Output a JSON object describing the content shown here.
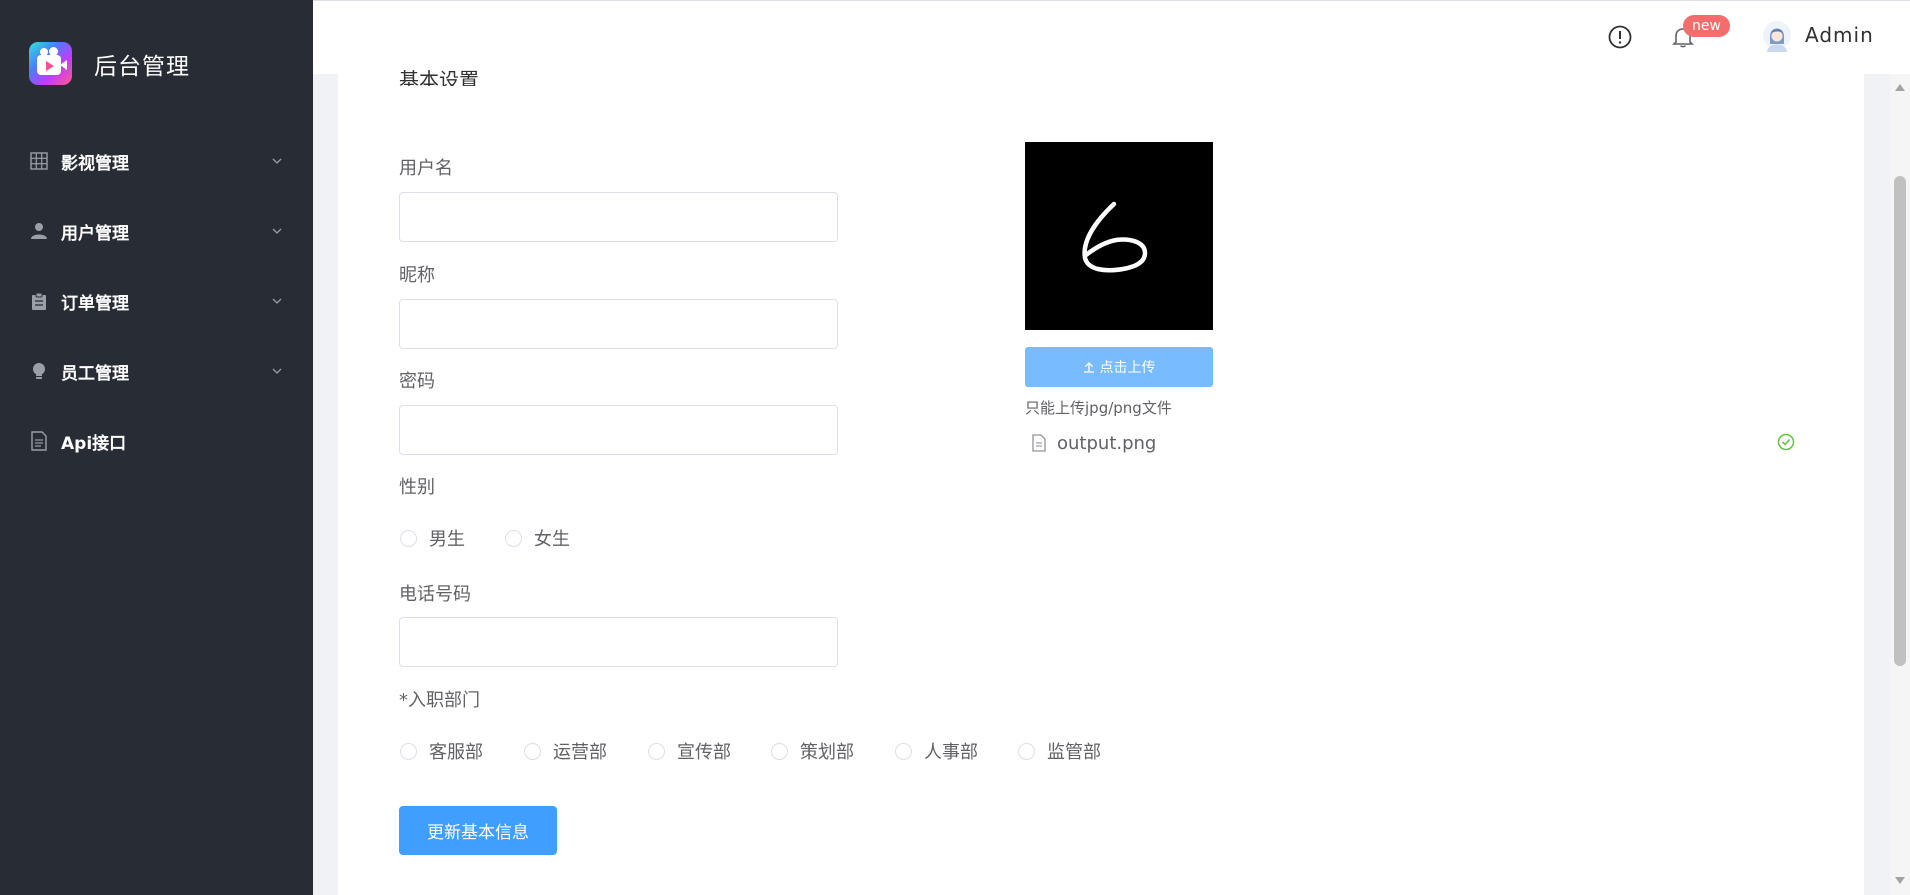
{
  "sidebar": {
    "brand_title": "后台管理",
    "items": [
      {
        "label": "影视管理",
        "icon": "grid-icon",
        "has_submenu": true
      },
      {
        "label": "用户管理",
        "icon": "user-icon",
        "has_submenu": true
      },
      {
        "label": "订单管理",
        "icon": "clipboard-icon",
        "has_submenu": true
      },
      {
        "label": "员工管理",
        "icon": "lightbulb-icon",
        "has_submenu": true
      },
      {
        "label": "Api接口",
        "icon": "document-icon",
        "has_submenu": false
      }
    ]
  },
  "header": {
    "info_icon": "info-icon",
    "bell_icon": "bell-icon",
    "badge": "new",
    "user_name": "Admin"
  },
  "form": {
    "section_title": "基本设置",
    "username_label": "用户名",
    "username_value": "",
    "nickname_label": "昵称",
    "nickname_value": "",
    "password_label": "密码",
    "password_value": "",
    "gender_label": "性别",
    "gender_options": [
      "男生",
      "女生"
    ],
    "phone_label": "电话号码",
    "phone_value": "",
    "department_label": "*入职部门",
    "department_options": [
      "客服部",
      "运营部",
      "宣传部",
      "策划部",
      "人事部",
      "监管部"
    ],
    "submit_label": "更新基本信息"
  },
  "upload": {
    "button_label": "点击上传",
    "tip": "只能上传jpg/png文件",
    "file_name": "output.png",
    "file_status": "success"
  },
  "colors": {
    "sidebar_bg": "#282c34",
    "primary": "#409eff",
    "upload_button": "#79bbff",
    "badge": "#f56c6c",
    "success": "#67c23a"
  }
}
